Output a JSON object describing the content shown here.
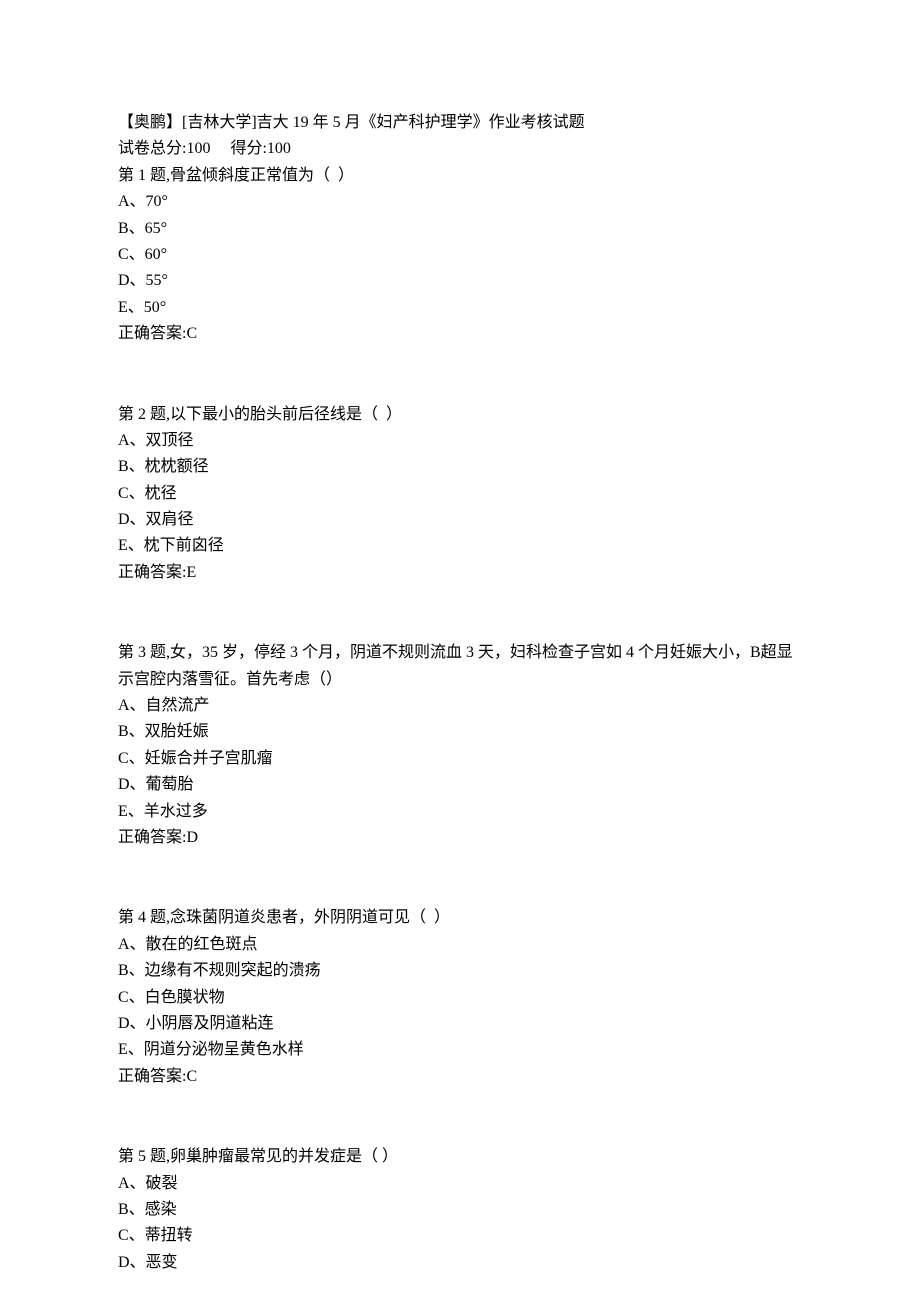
{
  "header": {
    "title": "【奥鹏】[吉林大学]吉大 19 年 5 月《妇产科护理学》作业考核试题",
    "score_line": "试卷总分:100     得分:100"
  },
  "questions": [
    {
      "prompt": "第 1 题,骨盆倾斜度正常值为（  ）",
      "options": [
        "A、70°",
        "B、65°",
        "C、60°",
        "D、55°",
        "E、50°"
      ],
      "answer": "正确答案:C"
    },
    {
      "prompt": "第 2 题,以下最小的胎头前后径线是（  ）",
      "options": [
        "A、双顶径",
        "B、枕枕额径",
        "C、枕径",
        "D、双肩径",
        "E、枕下前囟径"
      ],
      "answer": "正确答案:E"
    },
    {
      "prompt": "第 3 题,女，35 岁，停经 3 个月，阴道不规则流血 3 天，妇科检查子宫如 4 个月妊娠大小，B超显示宫腔内落雪征。首先考虑（）",
      "options": [
        "A、自然流产",
        "B、双胎妊娠",
        "C、妊娠合并子宫肌瘤",
        "D、葡萄胎",
        "E、羊水过多"
      ],
      "answer": "正确答案:D"
    },
    {
      "prompt": "第 4 题,念珠菌阴道炎患者，外阴阴道可见（  ）",
      "options": [
        "A、散在的红色斑点",
        "B、边缘有不规则突起的溃疡",
        "C、白色膜状物",
        "D、小阴唇及阴道粘连",
        "E、阴道分泌物呈黄色水样"
      ],
      "answer": "正确答案:C"
    },
    {
      "prompt": "第 5 题,卵巢肿瘤最常见的并发症是（ ）",
      "options": [
        "A、破裂",
        "B、感染",
        "C、蒂扭转",
        "D、恶变"
      ],
      "answer": ""
    }
  ]
}
